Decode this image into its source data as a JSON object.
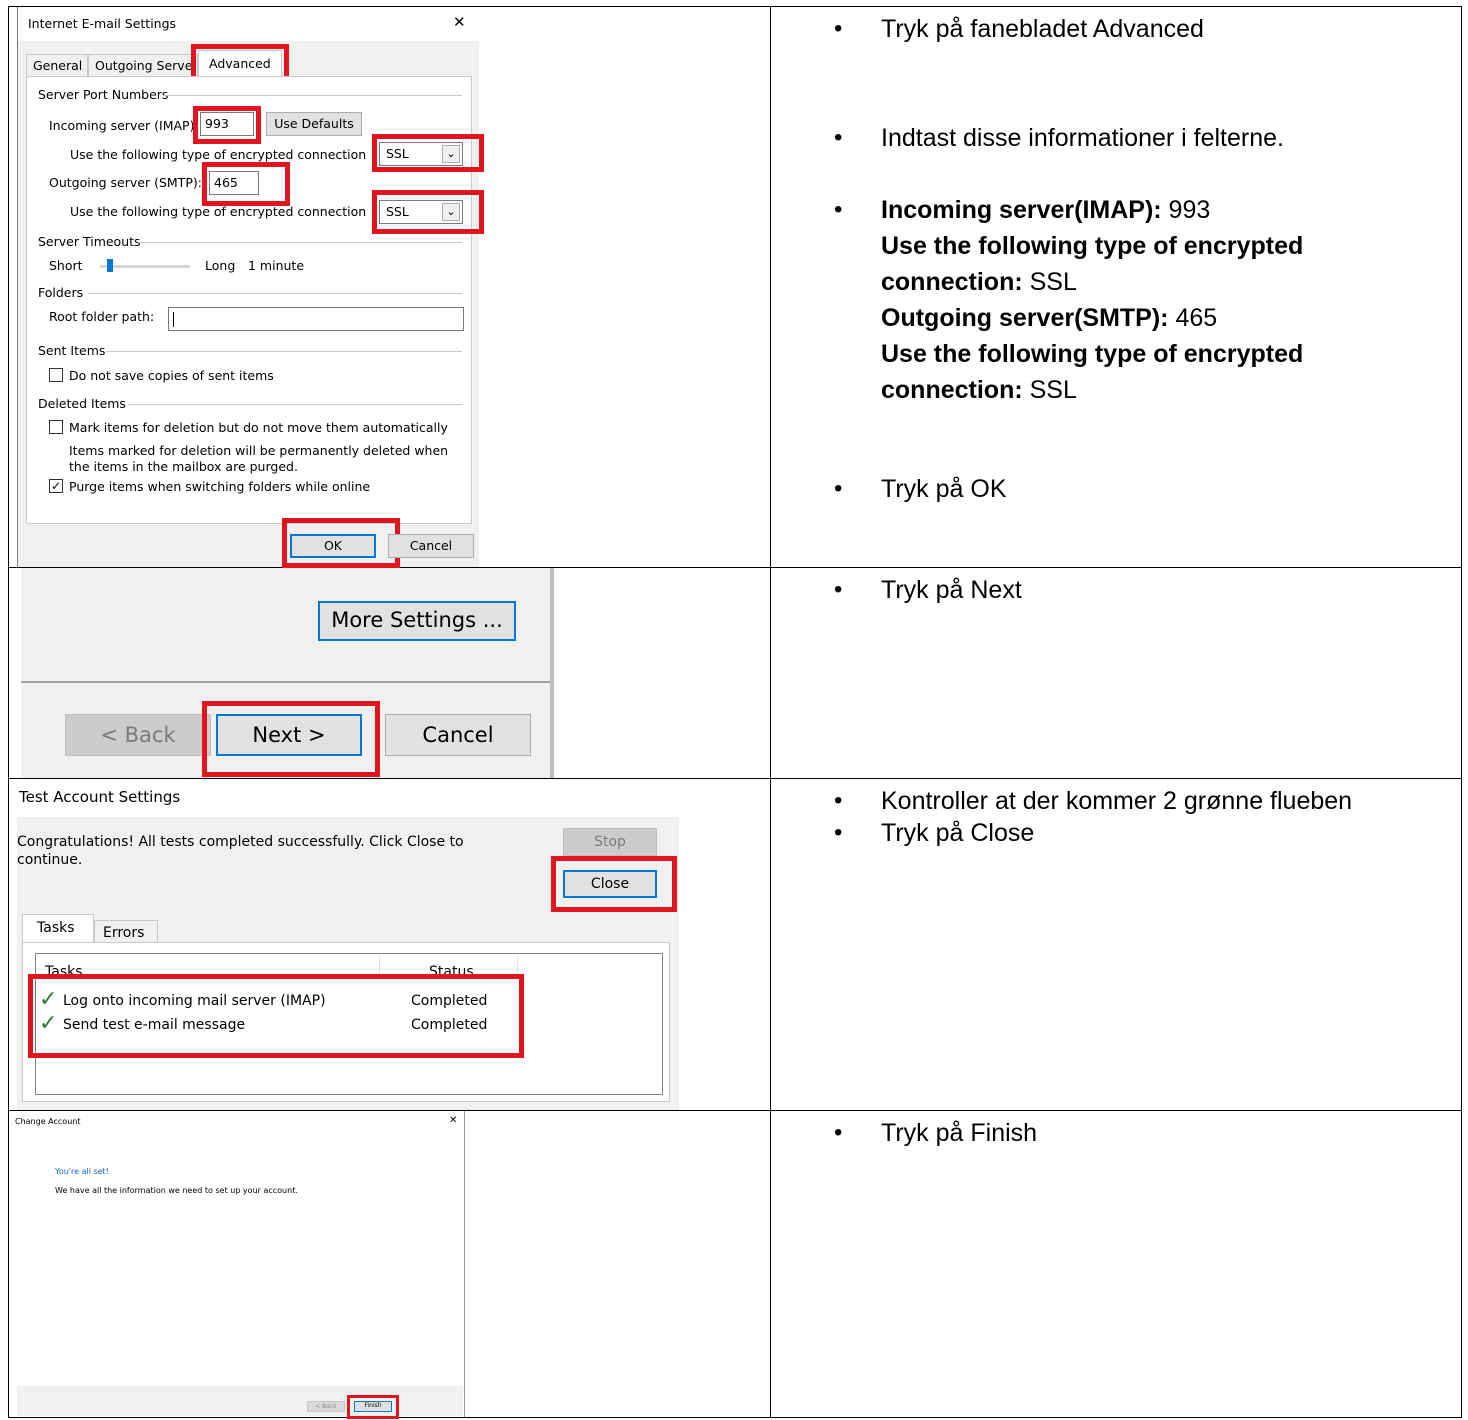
{
  "steps": [
    {
      "bullets": [
        [
          "Tryk på fanebladet Advanced"
        ],
        [
          "Indtast disse informationer i felterne."
        ],
        [
          {
            "b": "Incoming server(IMAP):",
            "t": " 993"
          },
          {
            "b": "Use the following type of encrypted",
            "t": ""
          },
          {
            "b": "connection:",
            "t": " SSL"
          },
          {
            "b": "Outgoing server(SMTP):",
            "t": " 465"
          },
          {
            "b": "Use the following type of encrypted",
            "t": ""
          },
          {
            "b": "connection:",
            "t": " SSL"
          }
        ],
        [
          "Tryk på OK"
        ]
      ]
    },
    {
      "bullets": [
        [
          "Tryk på Next"
        ]
      ]
    },
    {
      "bullets": [
        [
          "Kontroller at der kommer 2 grønne flueben"
        ],
        [
          "Tryk på Close"
        ]
      ]
    },
    {
      "bullets": [
        [
          "Tryk på Finish"
        ]
      ]
    }
  ],
  "email_settings": {
    "title": "Internet E-mail Settings",
    "close_glyph": "✕",
    "tabs": [
      "General",
      "Outgoing Serve",
      "Advanced"
    ],
    "group_port": "Server Port Numbers",
    "incoming_label": "Incoming server (IMAP):",
    "incoming_value": "993",
    "use_defaults": "Use Defaults",
    "enc_label": "Use the following type of encrypted connection",
    "enc_value": "SSL",
    "outgoing_label": "Outgoing server (SMTP):",
    "outgoing_value": "465",
    "group_timeouts": "Server Timeouts",
    "short": "Short",
    "long": "Long",
    "timeout_value": "1 minute",
    "group_folders": "Folders",
    "root_label": "Root folder path:",
    "group_sent": "Sent Items",
    "no_save": "Do not save copies of sent items",
    "group_deleted": "Deleted Items",
    "mark_items": "Mark items for deletion but do not move them automatically",
    "note_line1": "Items marked for deletion will be permanently deleted when",
    "note_line2": "the items in the mailbox are purged.",
    "purge": "Purge items when switching folders while online",
    "ok": "OK",
    "cancel": "Cancel"
  },
  "nav_dialog": {
    "more_settings": "More Settings ...",
    "back": "< Back",
    "next": "Next >",
    "cancel": "Cancel"
  },
  "test_dialog": {
    "title": "Test Account Settings",
    "message_line1": "Congratulations! All tests completed successfully. Click Close to",
    "message_line2": "continue.",
    "stop": "Stop",
    "close": "Close",
    "tabs": [
      "Tasks",
      "Errors"
    ],
    "col_tasks": "Tasks",
    "col_status": "Status",
    "rows": [
      {
        "task": "Log onto incoming mail server (IMAP)",
        "status": "Completed"
      },
      {
        "task": "Send test e-mail message",
        "status": "Completed"
      }
    ],
    "check_glyph": "✓"
  },
  "change_account": {
    "title": "Change Account",
    "close_glyph": "✕",
    "heading": "You're all set!",
    "body": "We have all the information we need to set up your account.",
    "back": "< Back",
    "finish": "Finish"
  },
  "colors": {
    "highlight": "#e0151e",
    "focus_blue": "#0078d7",
    "link_blue": "#1464be",
    "check_green": "#2a7d2a"
  }
}
